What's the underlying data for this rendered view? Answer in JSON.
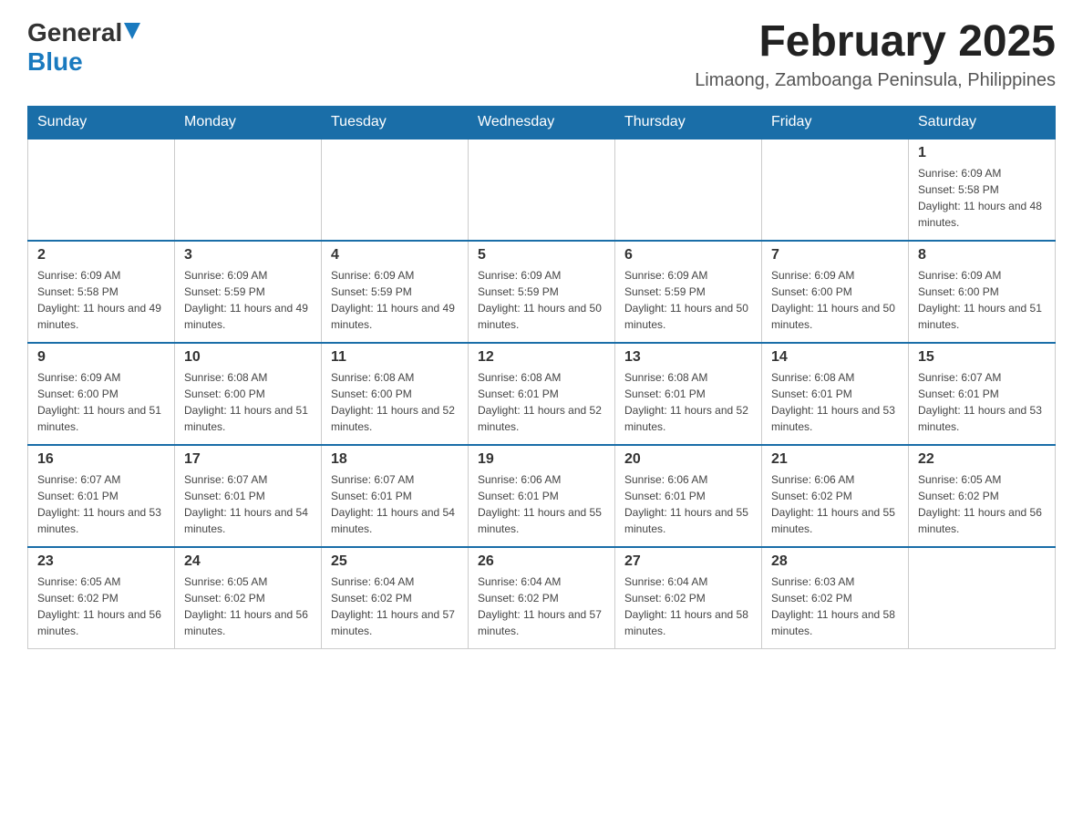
{
  "header": {
    "logo_general": "General",
    "logo_blue": "Blue",
    "month_title": "February 2025",
    "location": "Limaong, Zamboanga Peninsula, Philippines"
  },
  "weekdays": [
    "Sunday",
    "Monday",
    "Tuesday",
    "Wednesday",
    "Thursday",
    "Friday",
    "Saturday"
  ],
  "weeks": [
    [
      {
        "day": "",
        "info": ""
      },
      {
        "day": "",
        "info": ""
      },
      {
        "day": "",
        "info": ""
      },
      {
        "day": "",
        "info": ""
      },
      {
        "day": "",
        "info": ""
      },
      {
        "day": "",
        "info": ""
      },
      {
        "day": "1",
        "info": "Sunrise: 6:09 AM\nSunset: 5:58 PM\nDaylight: 11 hours and 48 minutes."
      }
    ],
    [
      {
        "day": "2",
        "info": "Sunrise: 6:09 AM\nSunset: 5:58 PM\nDaylight: 11 hours and 49 minutes."
      },
      {
        "day": "3",
        "info": "Sunrise: 6:09 AM\nSunset: 5:59 PM\nDaylight: 11 hours and 49 minutes."
      },
      {
        "day": "4",
        "info": "Sunrise: 6:09 AM\nSunset: 5:59 PM\nDaylight: 11 hours and 49 minutes."
      },
      {
        "day": "5",
        "info": "Sunrise: 6:09 AM\nSunset: 5:59 PM\nDaylight: 11 hours and 50 minutes."
      },
      {
        "day": "6",
        "info": "Sunrise: 6:09 AM\nSunset: 5:59 PM\nDaylight: 11 hours and 50 minutes."
      },
      {
        "day": "7",
        "info": "Sunrise: 6:09 AM\nSunset: 6:00 PM\nDaylight: 11 hours and 50 minutes."
      },
      {
        "day": "8",
        "info": "Sunrise: 6:09 AM\nSunset: 6:00 PM\nDaylight: 11 hours and 51 minutes."
      }
    ],
    [
      {
        "day": "9",
        "info": "Sunrise: 6:09 AM\nSunset: 6:00 PM\nDaylight: 11 hours and 51 minutes."
      },
      {
        "day": "10",
        "info": "Sunrise: 6:08 AM\nSunset: 6:00 PM\nDaylight: 11 hours and 51 minutes."
      },
      {
        "day": "11",
        "info": "Sunrise: 6:08 AM\nSunset: 6:00 PM\nDaylight: 11 hours and 52 minutes."
      },
      {
        "day": "12",
        "info": "Sunrise: 6:08 AM\nSunset: 6:01 PM\nDaylight: 11 hours and 52 minutes."
      },
      {
        "day": "13",
        "info": "Sunrise: 6:08 AM\nSunset: 6:01 PM\nDaylight: 11 hours and 52 minutes."
      },
      {
        "day": "14",
        "info": "Sunrise: 6:08 AM\nSunset: 6:01 PM\nDaylight: 11 hours and 53 minutes."
      },
      {
        "day": "15",
        "info": "Sunrise: 6:07 AM\nSunset: 6:01 PM\nDaylight: 11 hours and 53 minutes."
      }
    ],
    [
      {
        "day": "16",
        "info": "Sunrise: 6:07 AM\nSunset: 6:01 PM\nDaylight: 11 hours and 53 minutes."
      },
      {
        "day": "17",
        "info": "Sunrise: 6:07 AM\nSunset: 6:01 PM\nDaylight: 11 hours and 54 minutes."
      },
      {
        "day": "18",
        "info": "Sunrise: 6:07 AM\nSunset: 6:01 PM\nDaylight: 11 hours and 54 minutes."
      },
      {
        "day": "19",
        "info": "Sunrise: 6:06 AM\nSunset: 6:01 PM\nDaylight: 11 hours and 55 minutes."
      },
      {
        "day": "20",
        "info": "Sunrise: 6:06 AM\nSunset: 6:01 PM\nDaylight: 11 hours and 55 minutes."
      },
      {
        "day": "21",
        "info": "Sunrise: 6:06 AM\nSunset: 6:02 PM\nDaylight: 11 hours and 55 minutes."
      },
      {
        "day": "22",
        "info": "Sunrise: 6:05 AM\nSunset: 6:02 PM\nDaylight: 11 hours and 56 minutes."
      }
    ],
    [
      {
        "day": "23",
        "info": "Sunrise: 6:05 AM\nSunset: 6:02 PM\nDaylight: 11 hours and 56 minutes."
      },
      {
        "day": "24",
        "info": "Sunrise: 6:05 AM\nSunset: 6:02 PM\nDaylight: 11 hours and 56 minutes."
      },
      {
        "day": "25",
        "info": "Sunrise: 6:04 AM\nSunset: 6:02 PM\nDaylight: 11 hours and 57 minutes."
      },
      {
        "day": "26",
        "info": "Sunrise: 6:04 AM\nSunset: 6:02 PM\nDaylight: 11 hours and 57 minutes."
      },
      {
        "day": "27",
        "info": "Sunrise: 6:04 AM\nSunset: 6:02 PM\nDaylight: 11 hours and 58 minutes."
      },
      {
        "day": "28",
        "info": "Sunrise: 6:03 AM\nSunset: 6:02 PM\nDaylight: 11 hours and 58 minutes."
      },
      {
        "day": "",
        "info": ""
      }
    ]
  ]
}
